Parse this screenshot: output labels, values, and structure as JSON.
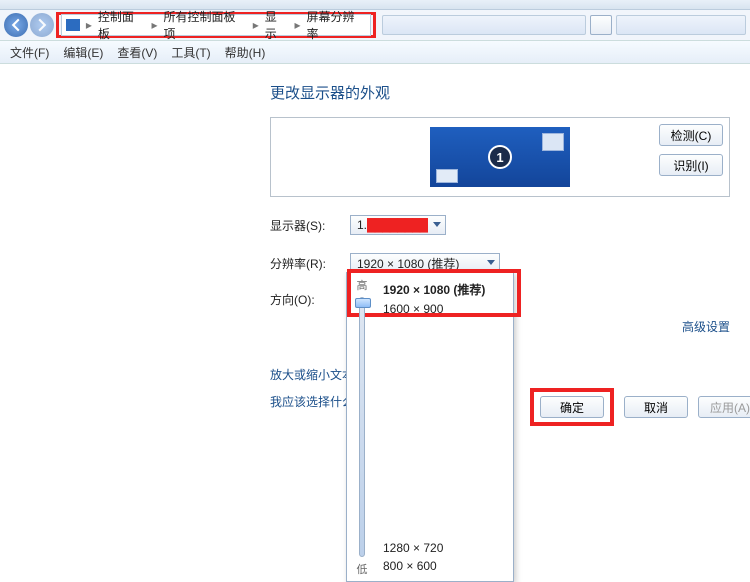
{
  "breadcrumb": {
    "items": [
      "控制面板",
      "所有控制面板项",
      "显示",
      "屏幕分辨率"
    ]
  },
  "menu": {
    "file": "文件(F)",
    "edit": "编辑(E)",
    "view": "查看(V)",
    "tools": "工具(T)",
    "help": "帮助(H)"
  },
  "page": {
    "heading": "更改显示器的外观",
    "detect": "检测(C)",
    "identify": "识别(I)",
    "monitor_number": "1"
  },
  "fields": {
    "display_label": "显示器(S):",
    "display_value_prefix": "1. ",
    "resolution_label": "分辨率(R):",
    "resolution_value": "1920 × 1080 (推荐)",
    "orientation_label": "方向(O):"
  },
  "links": {
    "text_size": "放大或缩小文本和其他项目",
    "which_settings": "我应该选择什么显示器设置?",
    "advanced": "高级设置"
  },
  "buttons": {
    "ok": "确定",
    "cancel": "取消",
    "apply": "应用(A)"
  },
  "resolution_popup": {
    "high": "高",
    "low": "低",
    "options": [
      "1920 × 1080 (推荐)",
      "1600 × 900",
      "1280 × 720",
      "800 × 600"
    ]
  }
}
